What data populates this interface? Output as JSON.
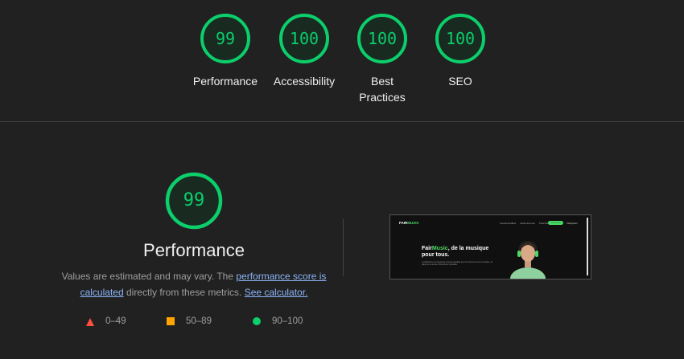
{
  "summary": {
    "gauges": [
      {
        "score": "99",
        "label": "Performance"
      },
      {
        "score": "100",
        "label": "Accessibility"
      },
      {
        "score": "100",
        "label": "Best Practices"
      },
      {
        "score": "100",
        "label": "SEO"
      }
    ]
  },
  "performance": {
    "score": "99",
    "title": "Performance",
    "desc_prefix": "Values are estimated and may vary. The ",
    "desc_link": "performance score is calculated",
    "desc_middle": " directly from these metrics. ",
    "desc_calc_link": "See calculator.",
    "legend": [
      {
        "range": "0–49",
        "shape": "triangle",
        "color": "#ff4e42"
      },
      {
        "range": "50–89",
        "shape": "square",
        "color": "#ffa400"
      },
      {
        "range": "90–100",
        "shape": "circle",
        "color": "#0cce6b"
      }
    ]
  },
  "screenshot": {
    "logo_a": "FAIR",
    "logo_b": "MUSIC",
    "nav_links": [
      "Fonctionnalités",
      "Abonnements",
      "Télécharger"
    ],
    "cta": "Connexion",
    "cta2": "Inscription",
    "hero_title_a": "Fair",
    "hero_title_b": "Music",
    "hero_title_c": ", de la musique pour tous.",
    "hero_sub": "La plateforme de streaming musical équitable pour les amoureux de la musique, où paient et ré-écoute. Rémunérez équitable."
  },
  "colors": {
    "pass": "#0cce6b",
    "average": "#ffa400",
    "fail": "#ff4e42",
    "link": "#8ab4f8"
  }
}
